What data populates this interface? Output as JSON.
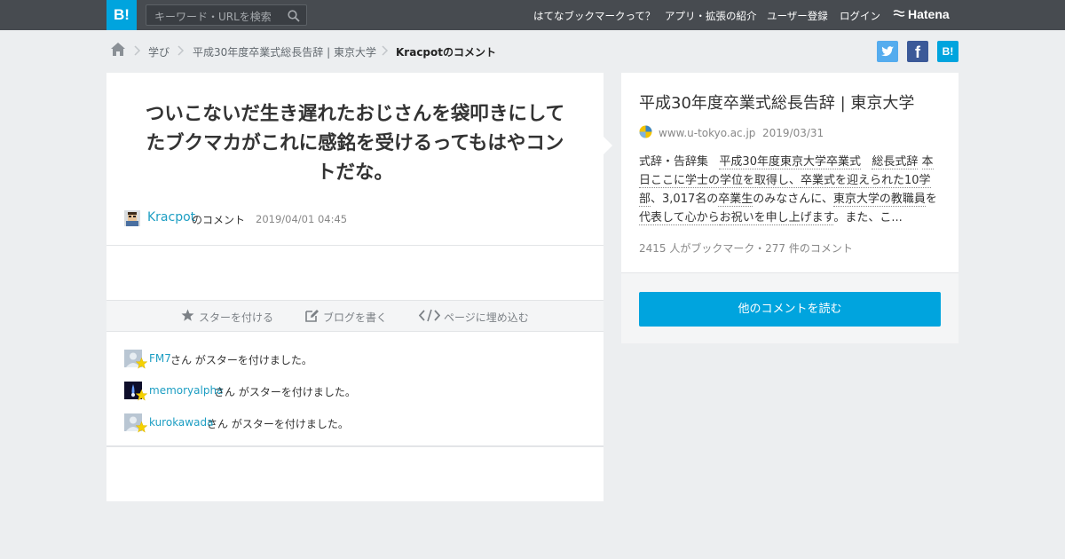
{
  "header": {
    "logo": "B!",
    "search_placeholder": "キーワード・URLを検索",
    "nav": [
      "はてなブックマークって？",
      "アプリ・拡張の紹介",
      "ユーザー登録",
      "ログイン"
    ],
    "hatena_logo": "Hatena"
  },
  "breadcrumb": {
    "items": [
      "学び",
      "平成30年度卒業式総長告辞 | 東京大学"
    ],
    "current": "Kracpotのコメント"
  },
  "share": {
    "facebook": "f",
    "hatena": "B!"
  },
  "comment": {
    "text": "ついこないだ生き遅れたおじさんを袋叩きにしてたブクマカがこれに感銘を受けるってもはやコントだな。",
    "user": "Kracpot",
    "user_suffix": "のコメント",
    "date": "2019/04/01 04:45"
  },
  "actions": {
    "star": "スターを付ける",
    "blog": "ブログを書く",
    "embed": "ページに埋め込む"
  },
  "stars": [
    {
      "user": "FM7",
      "text": "さん がスターを付けました。"
    },
    {
      "user": "memoryalpha",
      "text": "さん がスターを付けました。"
    },
    {
      "user": "kurokawada",
      "text": "さん がスターを付けました。"
    }
  ],
  "entry": {
    "title": "平成30年度卒業式総長告辞 | 東京大学",
    "domain": "www.u-tokyo.ac.jp",
    "date": "2019/03/31",
    "summary_line1_a": "式辞・告辞集",
    "summary_line1_b": "平成30年度東京大学卒業式",
    "summary_line1_c": "総長式辞",
    "summary_line1_d": "本",
    "summary_line2_a": "日ここに学士の学位を取得し、",
    "summary_line2_b": "卒業式を迎えられた10学",
    "summary_line3_a": "部",
    "summary_line3_b": "、3,017名の",
    "summary_line3_c": "卒業生",
    "summary_line3_d": "のみなさんに、",
    "summary_line3_e": "東京大学の教職員",
    "summary_line3_f": "を",
    "summary_line4_a": "代表して心から",
    "summary_line4_b": "お祝いを申し上げます",
    "summary_line4_c": "。また、こ...",
    "meta": "2415 人がブックマーク・277 件のコメント",
    "more_button": "他のコメントを読む"
  },
  "colors": {
    "accent": "#00a4de",
    "link": "#1d9ec3",
    "topbar": "#474b50"
  }
}
